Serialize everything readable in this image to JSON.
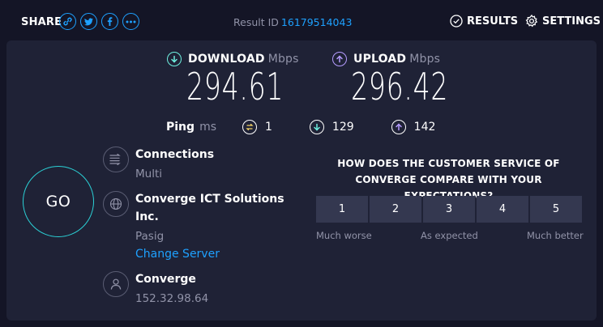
{
  "header": {
    "share_label": "SHARE",
    "share_icons": [
      "link-icon",
      "twitter-icon",
      "facebook-icon",
      "more-icon"
    ],
    "result_id_label": "Result ID",
    "result_id": "16179514043",
    "results_label": "RESULTS",
    "settings_label": "SETTINGS"
  },
  "download": {
    "label": "DOWNLOAD",
    "unit": "Mbps",
    "value": "294.61"
  },
  "upload": {
    "label": "UPLOAD",
    "unit": "Mbps",
    "value": "296.42"
  },
  "ping": {
    "label": "Ping",
    "unit": "ms",
    "jitter": "1",
    "download": "129",
    "upload": "142"
  },
  "go_label": "GO",
  "connections": {
    "title": "Connections",
    "value": "Multi"
  },
  "server": {
    "name": "Converge ICT Solutions Inc.",
    "location": "Pasig",
    "change_label": "Change Server"
  },
  "provider": {
    "name": "Converge",
    "ip": "152.32.98.64"
  },
  "survey": {
    "question": "HOW DOES THE CUSTOMER SERVICE OF CONVERGE COMPARE WITH YOUR EXPECTATIONS?",
    "options": [
      "1",
      "2",
      "3",
      "4",
      "5"
    ],
    "low_label": "Much worse",
    "mid_label": "As expected",
    "high_label": "Much better"
  },
  "colors": {
    "accent": "#1ea1ff",
    "download": "#6ef0e0",
    "upload": "#b59cff",
    "jitter": "#f2d366",
    "go_ring": "#2bd1d6",
    "background": "#141526",
    "panel": "#1f2236"
  }
}
